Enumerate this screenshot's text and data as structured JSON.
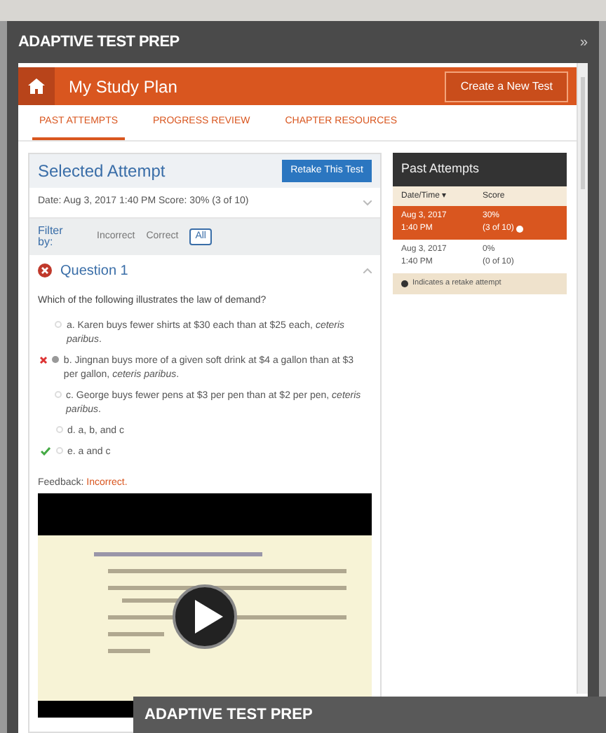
{
  "window": {
    "title": "ADAPTIVE TEST PREP",
    "close": "»"
  },
  "header": {
    "title": "My Study Plan",
    "button": "Create a New Test"
  },
  "tabs": [
    {
      "label": "PAST ATTEMPTS",
      "selected": true
    },
    {
      "label": "PROGRESS REVIEW",
      "selected": false
    },
    {
      "label": "CHAPTER RESOURCES",
      "selected": false
    }
  ],
  "selected_attempt": {
    "title": "Selected Attempt",
    "button": "Retake This Test",
    "summary": "Date: Aug 3, 2017 1:40 PM Score: 30% (3 of 10)",
    "filter": {
      "label": "Filter by:",
      "options": [
        {
          "label": "Incorrect",
          "selected": false
        },
        {
          "label": "Correct",
          "selected": false
        },
        {
          "label": "All",
          "selected": true
        }
      ]
    },
    "question": {
      "title": "Question 1",
      "correct": false,
      "expanded": true,
      "prompt": "Which of the following illustrates the law of demand?",
      "answers": [
        {
          "text": "a. Karen buys fewer shirts at $30 each than at $25 each, *ceteris paribus*.",
          "selected": false,
          "correct": false
        },
        {
          "text": "b. Jingnan buys more of a given soft drink at $4 a gallon than at $3 per gallon, *ceteris paribus*.",
          "selected": true,
          "correct": false
        },
        {
          "text": "c. George buys fewer pens at $3 per pen than at $2 per pen, *ceteris paribus*.",
          "selected": false,
          "correct": false
        },
        {
          "text": "d. a, b, and c",
          "selected": false,
          "correct": false
        },
        {
          "text": "e. a and c",
          "selected": false,
          "correct": true
        }
      ],
      "feedback_label": "Feedback:",
      "feedback": "Incorrect."
    }
  },
  "past_attempts": {
    "title": "Past Attempts",
    "columns": [
      "Date/Time ▾",
      "Score"
    ],
    "rows": [
      {
        "date": "Aug 3, 2017",
        "time": "1:40 PM",
        "score": "30%",
        "detail": "(3 of 10)",
        "retake": true,
        "selected": true
      },
      {
        "date": "Aug 3, 2017",
        "time": "1:40 PM",
        "score": "0%",
        "detail": "(0 of 10)",
        "retake": false,
        "selected": false
      }
    ],
    "note": "Indicates a retake attempt"
  },
  "second_window": {
    "title": "ADAPTIVE TEST PREP"
  }
}
